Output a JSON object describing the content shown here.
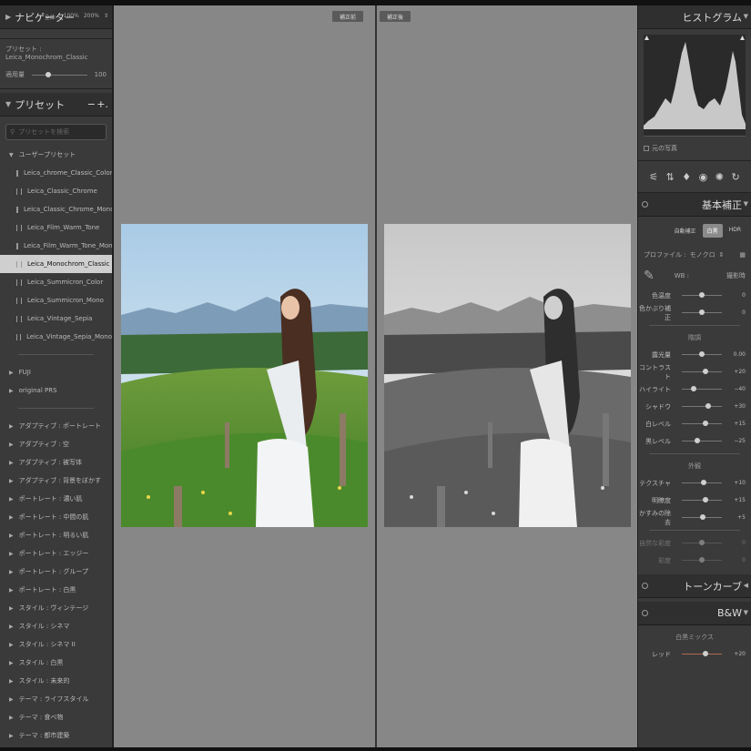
{
  "navigator": {
    "title": "ナビゲーター",
    "fit": "全体 :",
    "z100": "100%",
    "z200": "200%"
  },
  "preset_info": {
    "label": "プリセット : Leica_Monochrom_Classic",
    "amount_label": "適用量",
    "amount_value": "100",
    "amount_fraction": 0.3
  },
  "presets": {
    "title": "プリセット",
    "minus": "−",
    "plus": "+.",
    "search_placeholder": "プリセットを検索",
    "user_folder": "ユーザープリセット",
    "user_items": [
      "Leica_chrome_Classic_Color",
      "Leica_Classic_Chrome",
      "Leica_Classic_Chrome_Mono",
      "Leica_Film_Warm_Tone",
      "Leica_Film_Warm_Tone_Mono",
      "Leica_Monochrom_Classic",
      "Leica_Summicron_Color",
      "Leica_Summicron_Mono",
      "Leica_Vintage_Sepia",
      "Leica_Vintage_Sepia_Mono"
    ],
    "selected_index": 5,
    "folders1": [
      "FUJI",
      "original PRS"
    ],
    "folders2": [
      "アダプティブ : ポートレート",
      "アダプティブ : 空",
      "アダプティブ : 被写体",
      "アダプティブ : 背景をぼかす",
      "ポートレート : 濃い肌",
      "ポートレート : 中間の肌",
      "ポートレート : 明るい肌",
      "ポートレート : エッジー",
      "ポートレート : グループ",
      "ポートレート : 白黒",
      "スタイル : ヴィンテージ",
      "スタイル : シネマ",
      "スタイル : シネマ II",
      "スタイル : 白黒",
      "スタイル : 未来的",
      "テーマ : ライフスタイル",
      "テーマ : 食べ物",
      "テーマ : 都市建築"
    ]
  },
  "view": {
    "before_label": "補正前",
    "after_label": "補正後"
  },
  "histogram": {
    "title": "ヒストグラム",
    "original_photo": "元の写真"
  },
  "basic": {
    "title": "基本補正",
    "buttons": [
      "自動補正",
      "白黒",
      "HDR"
    ],
    "active_button": 1,
    "profile_label": "プロファイル :",
    "profile_value": "モノクロ",
    "wb_label": "WB :",
    "wb_value": "撮影時",
    "wb_sliders": [
      {
        "label": "色温度",
        "value": "0",
        "pos": 0.5
      },
      {
        "label": "色かぶり補正",
        "value": "0",
        "pos": 0.5
      }
    ],
    "tone_section": "階調",
    "tone_sliders": [
      {
        "label": "露光量",
        "value": "0.00",
        "pos": 0.5
      },
      {
        "label": "コントラスト",
        "value": "+20",
        "pos": 0.6
      },
      {
        "label": "ハイライト",
        "value": "−40",
        "pos": 0.3
      },
      {
        "label": "シャドウ",
        "value": "+30",
        "pos": 0.65
      },
      {
        "label": "白レベル",
        "value": "+15",
        "pos": 0.58
      },
      {
        "label": "黒レベル",
        "value": "−25",
        "pos": 0.38
      }
    ],
    "presence_section": "外観",
    "presence_sliders": [
      {
        "label": "テクスチャ",
        "value": "+10",
        "pos": 0.55
      },
      {
        "label": "明瞭度",
        "value": "+15",
        "pos": 0.58
      },
      {
        "label": "かすみの除去",
        "value": "+5",
        "pos": 0.52
      }
    ],
    "color_sliders": [
      {
        "label": "自然な彩度",
        "value": "0",
        "pos": 0.5
      },
      {
        "label": "彩度",
        "value": "0",
        "pos": 0.5
      }
    ]
  },
  "tonecurve": {
    "title": "トーンカーブ"
  },
  "bw": {
    "title": "B&W",
    "mix_label": "白黒ミックス",
    "red_label": "レッド",
    "red_value": "+20",
    "red_pos": 0.6
  }
}
